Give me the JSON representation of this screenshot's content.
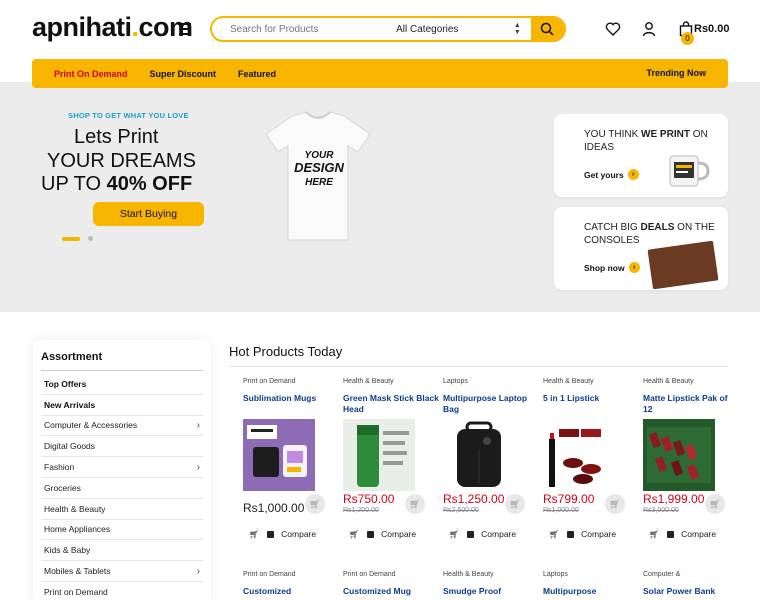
{
  "header": {
    "logo_main": "apnihati",
    "logo_dot": ".",
    "logo_tail": "com",
    "search_placeholder": "Search for Products",
    "category_select": "All Categories",
    "cart_count": "0",
    "cart_total": "Rs0.00"
  },
  "nav": {
    "items": [
      "Print On Demand",
      "Super Discount",
      "Featured"
    ],
    "right": "Trending Now"
  },
  "hero": {
    "kicker": "SHOP TO GET WHAT YOU LOVE",
    "line1": "Lets Print",
    "line2": "YOUR DREAMS",
    "line3_prefix": "UP TO ",
    "line3_bold": "40% OFF",
    "cta": "Start Buying",
    "tshirt_text": [
      "YOUR",
      "DESIGN",
      "HERE"
    ]
  },
  "promos": [
    {
      "pre": "YOU THINK ",
      "bold": "WE PRINT",
      "post": " ON IDEAS",
      "link": "Get yours"
    },
    {
      "pre": "CATCH BIG ",
      "bold": "DEALS",
      "post": " ON THE CONSOLES",
      "link": "Shop now"
    }
  ],
  "sidebar": {
    "title": "Assortment",
    "items": [
      {
        "label": "Top Offers",
        "bold": true,
        "arrow": false
      },
      {
        "label": "New Arrivals",
        "bold": true,
        "arrow": false
      },
      {
        "label": "Computer & Accessories",
        "bold": false,
        "arrow": true
      },
      {
        "label": "Digital Goods",
        "bold": false,
        "arrow": false
      },
      {
        "label": "Fashion",
        "bold": false,
        "arrow": true
      },
      {
        "label": "Groceries",
        "bold": false,
        "arrow": false
      },
      {
        "label": "Health & Beauty",
        "bold": false,
        "arrow": false
      },
      {
        "label": "Home Appliances",
        "bold": false,
        "arrow": false
      },
      {
        "label": "Kids & Baby",
        "bold": false,
        "arrow": false
      },
      {
        "label": "Mobiles & Tablets",
        "bold": false,
        "arrow": true
      },
      {
        "label": "Print on Demand",
        "bold": false,
        "arrow": false
      }
    ]
  },
  "hot": {
    "title": "Hot Products Today",
    "compare_label": "Compare",
    "products": [
      {
        "category": "Print on Demand",
        "name": "Sublimation Mugs",
        "old_price": "",
        "price": "Rs1,000.00",
        "sale": false,
        "image": "mug"
      },
      {
        "category": "Health & Beauty",
        "name": "Green Mask Stick Black Head",
        "old_price": "Rs1,200.00",
        "price": "Rs750.00",
        "sale": true,
        "image": "greenstick"
      },
      {
        "category": "Laptops",
        "name": "Multipurpose Laptop Bag",
        "old_price": "Rs2,500.00",
        "price": "Rs1,250.00",
        "sale": true,
        "image": "bag"
      },
      {
        "category": "Health & Beauty",
        "name": "5 in 1 Lipstick",
        "old_price": "Rs1,000.00",
        "price": "Rs799.00",
        "sale": true,
        "image": "lipstick"
      },
      {
        "category": "Health & Beauty",
        "name": "Matte Lipstick Pak of 12",
        "old_price": "Rs3,000.00",
        "price": "Rs1,999.00",
        "sale": true,
        "image": "lipstickpack"
      }
    ],
    "products_row2": [
      {
        "category": "Print on Demand",
        "name": "Customized"
      },
      {
        "category": "Print on Demand",
        "name": "Customized Mug"
      },
      {
        "category": "Health & Beauty",
        "name": "Smudge Proof"
      },
      {
        "category": "Laptops",
        "name": "Multipurpose"
      },
      {
        "category": "Computer &",
        "name": "Solar Power Bank"
      }
    ]
  },
  "colors": {
    "accent": "#f7b500",
    "sale": "#d0021b",
    "link": "#0f3d8a"
  }
}
